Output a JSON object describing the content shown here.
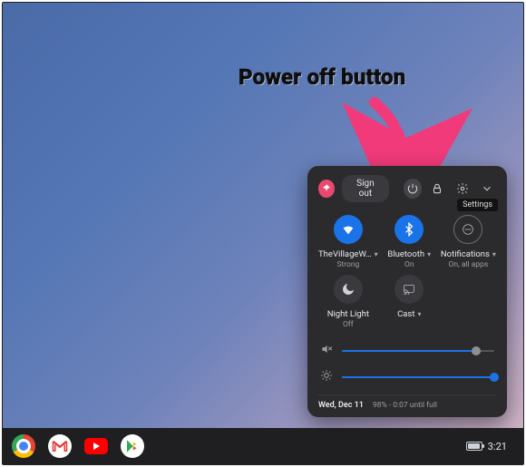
{
  "annotation": {
    "label": "Power off button"
  },
  "panel": {
    "sign_out": "Sign out",
    "tooltip_settings": "Settings",
    "tiles": {
      "wifi": {
        "label": "TheVillageW…",
        "sub": "Strong"
      },
      "bt": {
        "label": "Bluetooth",
        "sub": "On"
      },
      "notif": {
        "label": "Notifications",
        "sub": "On, all apps"
      },
      "night": {
        "label": "Night Light",
        "sub": "Off"
      },
      "cast": {
        "label": "Cast",
        "sub": ""
      }
    },
    "footer": {
      "date": "Wed, Dec 11",
      "battery": "98% - 0:07 until full"
    }
  },
  "shelf": {
    "time": "3:21"
  },
  "colors": {
    "accent": "#1a73e8",
    "panel_bg": "#2b2b2e",
    "annotation_arrow": "#f13a7a"
  }
}
